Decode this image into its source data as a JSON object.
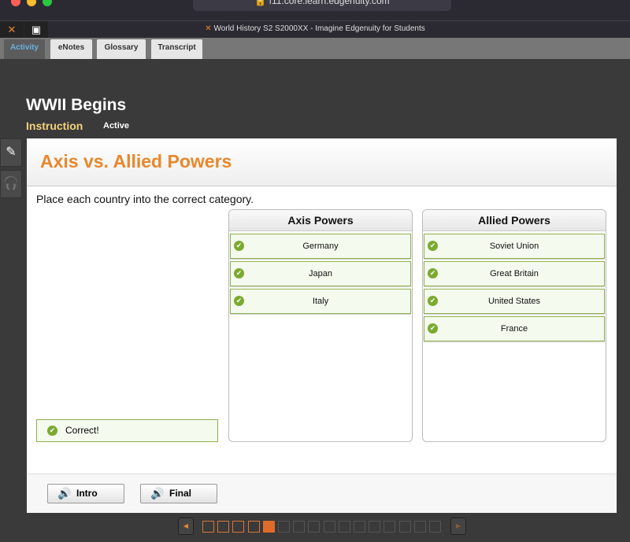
{
  "browser": {
    "url": "f11.core.learn.edgenuity.com",
    "window_title": "World History S2 S2000XX - Imagine Edgenuity for Students"
  },
  "nav_tabs": [
    {
      "label": "Activity",
      "active": true
    },
    {
      "label": "eNotes"
    },
    {
      "label": "Glossary"
    },
    {
      "label": "Transcript"
    }
  ],
  "lesson": {
    "title": "WWII Begins",
    "section": "Instruction",
    "status": "Active"
  },
  "activity": {
    "title": "Axis vs. Allied Powers",
    "instruction": "Place each country into the correct category.",
    "columns": [
      {
        "header": "Axis Powers",
        "items": [
          "Germany",
          "Japan",
          "Italy"
        ]
      },
      {
        "header": "Allied Powers",
        "items": [
          "Soviet Union",
          "Great Britain",
          "United States",
          "France"
        ]
      }
    ],
    "feedback": "Correct!"
  },
  "footer": {
    "intro_label": "Intro",
    "final_label": "Final"
  },
  "pager": {
    "total": 16,
    "current": 5,
    "completed": 4
  },
  "colors": {
    "accent": "#e8872b",
    "correct": "#7aaa2f"
  }
}
